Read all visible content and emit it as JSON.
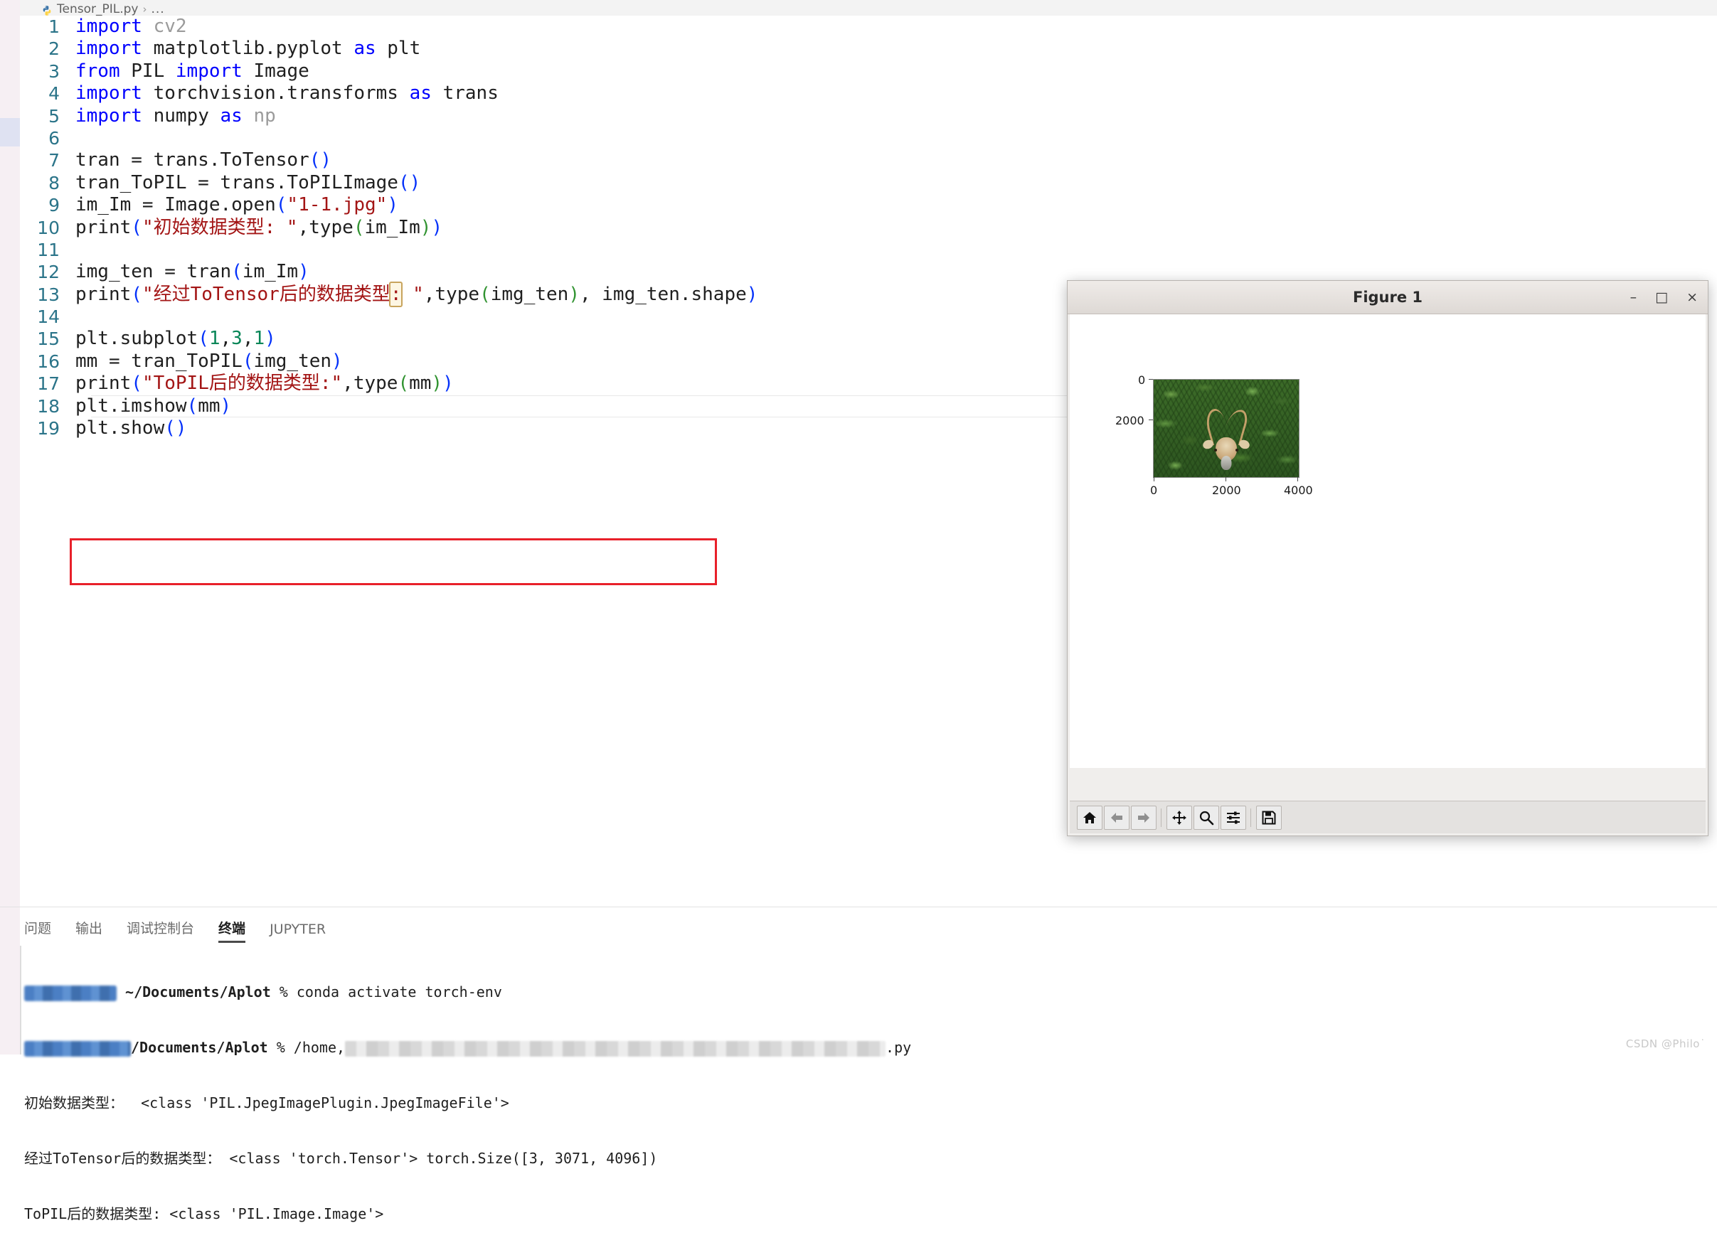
{
  "breadcrumb": {
    "file_icon": "python-file-icon",
    "file_name": "Tensor_PIL.py",
    "separator": "›",
    "ellipsis": "..."
  },
  "editor": {
    "lines": [
      {
        "n": "1",
        "text": "import cv2"
      },
      {
        "n": "2",
        "text": "import matplotlib.pyplot as plt"
      },
      {
        "n": "3",
        "text": "from PIL import Image"
      },
      {
        "n": "4",
        "text": "import torchvision.transforms as trans"
      },
      {
        "n": "5",
        "text": "import numpy as np"
      },
      {
        "n": "6",
        "text": ""
      },
      {
        "n": "7",
        "text": "tran = trans.ToTensor()"
      },
      {
        "n": "8",
        "text": "tran_ToPIL = trans.ToPILImage()"
      },
      {
        "n": "9",
        "text": "im_Im = Image.open(\"1-1.jpg\")"
      },
      {
        "n": "10",
        "text": "print(\"初始数据类型: \",type(im_Im))"
      },
      {
        "n": "11",
        "text": ""
      },
      {
        "n": "12",
        "text": "img_ten = tran(im_Im)"
      },
      {
        "n": "13",
        "text": "print(\"经过ToTensor后的数据类型: \",type(img_ten), img_ten.shape)"
      },
      {
        "n": "14",
        "text": ""
      },
      {
        "n": "15",
        "text": "plt.subplot(1,3,1)"
      },
      {
        "n": "16",
        "text": "mm = tran_ToPIL(img_ten)"
      },
      {
        "n": "17",
        "text": "print(\"ToPIL后的数据类型:\",type(mm))"
      },
      {
        "n": "18",
        "text": "plt.imshow(mm)"
      },
      {
        "n": "19",
        "text": "plt.show()"
      }
    ],
    "selection_char": ":",
    "annotation_color": "#e8202a"
  },
  "figure_window": {
    "title": "Figure 1",
    "minimize_label": "–",
    "maximize_label": "□",
    "close_label": "×",
    "toolbar": [
      {
        "name": "home-icon",
        "tooltip": "Home",
        "disabled": false
      },
      {
        "name": "back-arrow-icon",
        "tooltip": "Back",
        "disabled": true
      },
      {
        "name": "forward-arrow-icon",
        "tooltip": "Forward",
        "disabled": true
      },
      {
        "name": "pan-icon",
        "tooltip": "Pan",
        "disabled": false
      },
      {
        "name": "zoom-icon",
        "tooltip": "Zoom",
        "disabled": false
      },
      {
        "name": "subplot-config-icon",
        "tooltip": "Configure subplots",
        "disabled": false
      },
      {
        "name": "save-icon",
        "tooltip": "Save",
        "disabled": false
      }
    ]
  },
  "chart_data": {
    "type": "heatmap",
    "title": "",
    "xlabel": "",
    "ylabel": "",
    "x_ticks": [
      "0",
      "2000",
      "4000"
    ],
    "y_ticks": [
      "0",
      "2000"
    ],
    "xlim": [
      0,
      4096
    ],
    "ylim": [
      3071,
      0
    ],
    "grid": false,
    "legend": "none",
    "description": "imshow of a PIL image: a deer with antlers in dense green foliage",
    "image_shape": [
      3,
      3071,
      4096
    ]
  },
  "panel": {
    "tabs": [
      {
        "label": "问题",
        "active": false
      },
      {
        "label": "输出",
        "active": false
      },
      {
        "label": "调试控制台",
        "active": false
      },
      {
        "label": "终端",
        "active": true
      },
      {
        "label": "JUPYTER",
        "active": false
      }
    ],
    "terminal": {
      "line1_path": "~/Documents/Aplot",
      "line1_cmd": "% conda activate torch-env",
      "line2_path": "/Documents/Aplot",
      "line2_cmd": "% /home,",
      "line2_tail": ".py",
      "line3": "初始数据类型：  <class 'PIL.JpegImagePlugin.JpegImageFile'>",
      "line4": "经过ToTensor后的数据类型： <class 'torch.Tensor'> torch.Size([3, 3071, 4096])",
      "line5": "ToPIL后的数据类型: <class 'PIL.Image.Image'>"
    }
  },
  "watermark": "CSDN @Philo˙"
}
